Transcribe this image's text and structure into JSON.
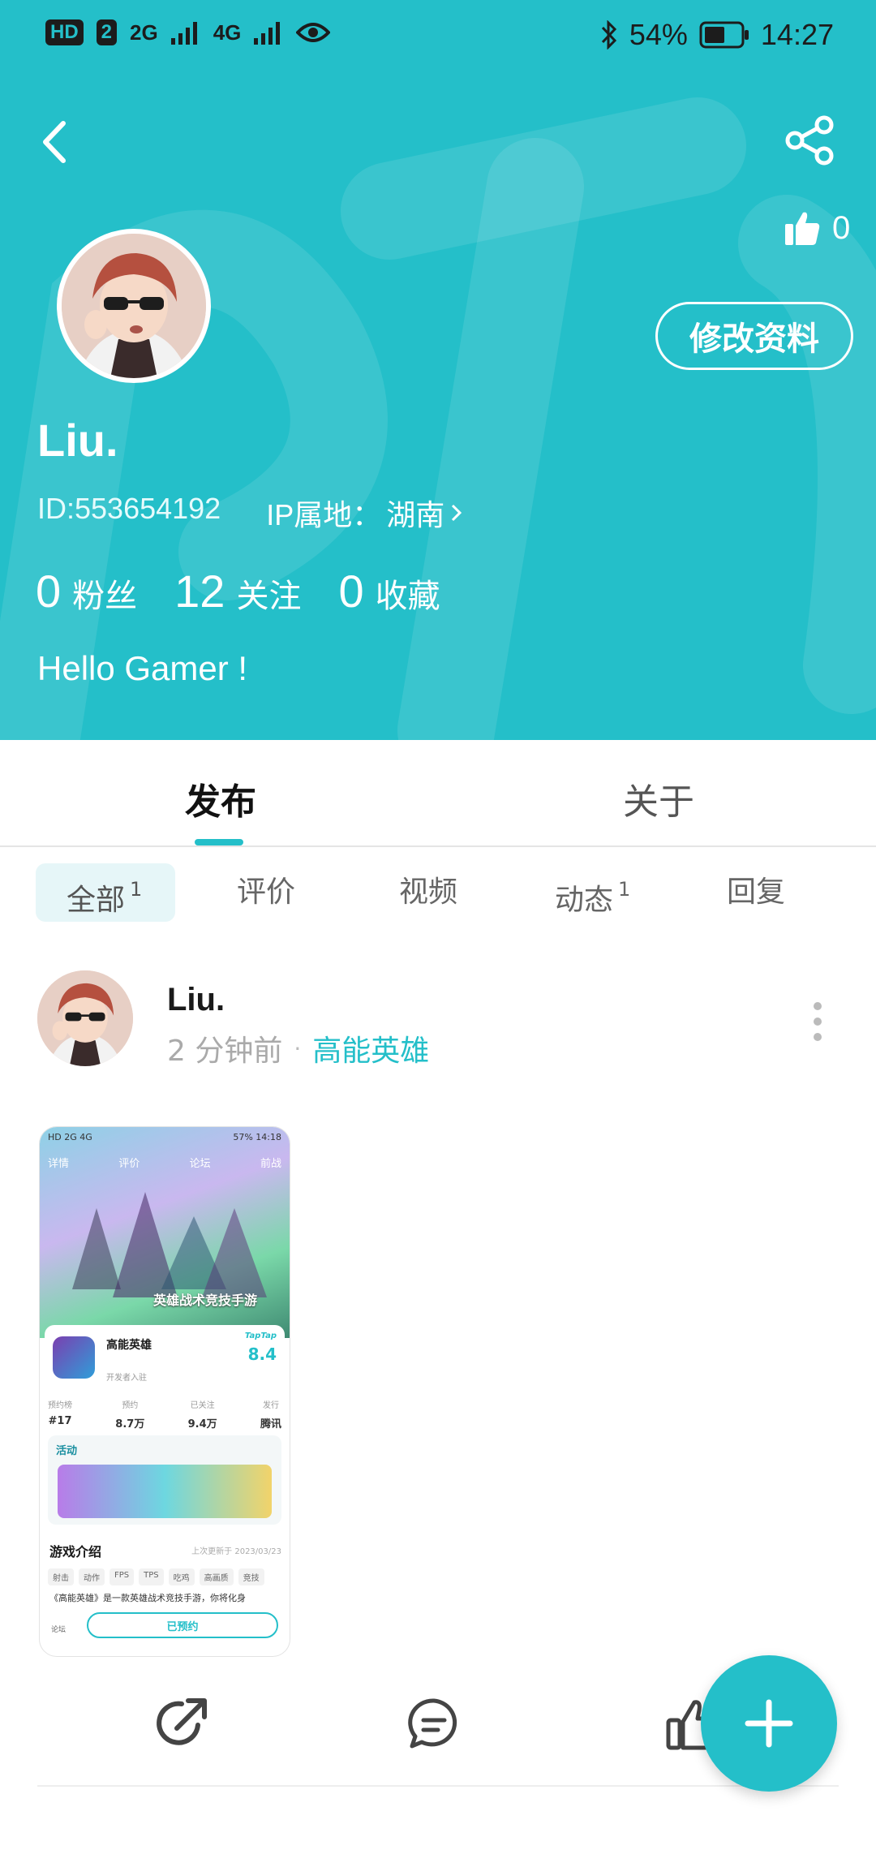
{
  "status_bar": {
    "hd": "HD",
    "sim": "2",
    "net1": "2G",
    "net2": "4G",
    "battery": "54%",
    "time": "14:27"
  },
  "header": {
    "likes_count": "0",
    "edit_label": "修改资料",
    "username": "Liu.",
    "id_text": "ID:553654192",
    "ip_label": "IP属地：",
    "ip_value": "湖南",
    "stats": [
      {
        "num": "0",
        "label": "粉丝"
      },
      {
        "num": "12",
        "label": "关注"
      },
      {
        "num": "0",
        "label": "收藏"
      }
    ],
    "bio": "Hello Gamer !",
    "accent": "#24bfc9"
  },
  "tabs": {
    "publish": "发布",
    "about": "关于"
  },
  "filters": {
    "all": "全部",
    "all_count": "1",
    "review": "评价",
    "video": "视频",
    "feed": "动态",
    "feed_count": "1",
    "reply": "回复"
  },
  "post": {
    "author": "Liu.",
    "time": "2 分钟前",
    "separator": "·",
    "game": "高能英雄",
    "screenshot": {
      "status_left": "HD 2G 4G",
      "status_right": "57% 14:18",
      "nav_detail": "详情",
      "nav_review": "评价",
      "nav_forum": "论坛",
      "nav_home": "前战",
      "banner_text": "英雄战术竞技手游",
      "game_title": "高能英雄",
      "developer": "开发者入驻",
      "score_label": "TapTap",
      "score": "8.4",
      "stats": [
        {
          "label": "预约榜",
          "value": "#17"
        },
        {
          "label": "预约",
          "value": "8.7万"
        },
        {
          "label": "已关注",
          "value": "9.4万"
        },
        {
          "label": "发行",
          "value": "腾讯"
        }
      ],
      "activity_title": "活动",
      "intro_title": "游戏介绍",
      "updated": "上次更新于 2023/03/23",
      "tags": [
        "射击",
        "动作",
        "FPS",
        "TPS",
        "吃鸡",
        "高画质",
        "竞技"
      ],
      "desc": "《高能英雄》是一款英雄战术竞技手游，你将化身",
      "forum_label": "论坛",
      "reserved_label": "已预约"
    }
  }
}
